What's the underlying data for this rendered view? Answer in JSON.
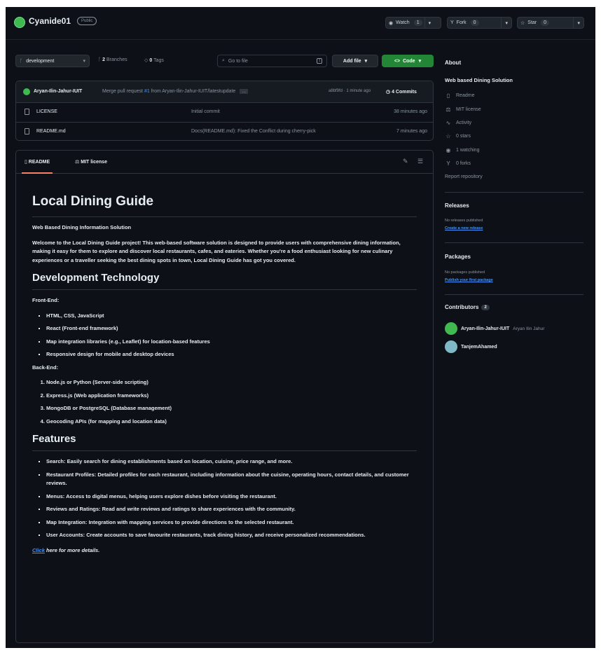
{
  "header": {
    "repo_name": "Cyanide01",
    "visibility": "Public",
    "watch_label": "Watch",
    "watch_count": "1",
    "fork_label": "Fork",
    "fork_count": "0",
    "star_label": "Star",
    "star_count": "0"
  },
  "toolbar": {
    "branch": "development",
    "branches_count": "2",
    "branches_label": "Branches",
    "tags_count": "0",
    "tags_label": "Tags",
    "search_placeholder": "Go to file",
    "kbd": "t",
    "add_file": "Add file",
    "code": "Code"
  },
  "commit": {
    "author": "Aryan-Ilin-Jahur-IUIT",
    "msg_prefix": "Merge pull request",
    "pr": "#1",
    "msg_suffix": "from Aryan-Ilin-Jahur-IUIT/latestupdate",
    "ellipsis": "...",
    "sha": "a8bf9fd · 1 minute ago",
    "commits": "4 Commits"
  },
  "files": [
    {
      "name": "LICENSE",
      "message": "Initial commit",
      "time": "38 minutes ago"
    },
    {
      "name": "README.md",
      "message": "Docs(README.md): Fixed the Conflict during cherry-pick",
      "time": "7 minutes ago"
    }
  ],
  "readme_tabs": {
    "readme": "README",
    "license": "MIT license"
  },
  "readme": {
    "title": "Local Dining Guide",
    "subtitle": "Web Based Dining Information Solution",
    "intro": "Welcome to the Local Dining Guide project! This web-based software solution is designed to provide users with comprehensive dining information, making it easy for them to explore and discover local restaurants, cafes, and eateries. Whether you're a food enthusiast looking for new culinary experiences or a traveller seeking the best dining spots in town, Local Dining Guide has got you covered.",
    "tech_heading": "Development Technology",
    "frontend_label": "Front-End:",
    "frontend": [
      "HTML, CSS, JavaScript",
      "React (Front-end framework)",
      "Map integration libraries (e.g., Leaflet) for location-based features",
      "Responsive design for mobile and desktop devices"
    ],
    "backend_label": "Back-End:",
    "backend": [
      "Node.js or Python (Server-side scripting)",
      "Express.js (Web application frameworks)",
      "MongoDB or PostgreSQL (Database management)",
      "Geocoding APIs (for mapping and location data)"
    ],
    "features_heading": "Features",
    "features": [
      {
        "name": "Search:",
        "text": "Easily search for dining establishments based on location, cuisine, price range, and more."
      },
      {
        "name": "Restaurant Profiles:",
        "text": "Detailed profiles for each restaurant, including information about the cuisine, operating hours, contact details, and customer reviews."
      },
      {
        "name": "Menus:",
        "text": "Access to digital menus, helping users explore dishes before visiting the restaurant."
      },
      {
        "name": "Reviews and Ratings:",
        "text": "Read and write reviews and ratings to share experiences with the community."
      },
      {
        "name": "Map Integration:",
        "text": "Integration with mapping services to provide directions to the selected restaurant."
      },
      {
        "name": "User Accounts:",
        "text": "Create accounts to save favourite restaurants, track dining history, and receive personalized recommendations."
      }
    ],
    "click_link": "Click",
    "click_suffix": " here for more details."
  },
  "about": {
    "heading": "About",
    "description": "Web based Dining Solution",
    "readme": "Readme",
    "license": "MIT license",
    "activity": "Activity",
    "stars": "0 stars",
    "watching": "1 watching",
    "forks": "0 forks",
    "report": "Report repository"
  },
  "releases": {
    "heading": "Releases",
    "none": "No releases published",
    "link": "Create a new release"
  },
  "packages": {
    "heading": "Packages",
    "none": "No packages published",
    "link": "Publish your first package"
  },
  "contributors": {
    "heading": "Contributors",
    "count": "2",
    "list": [
      {
        "login": "Aryan-Ilin-Jahur-IUIT",
        "name": "Aryan Ilin Jahur"
      },
      {
        "login": "TanjemAhamed",
        "name": ""
      }
    ]
  }
}
